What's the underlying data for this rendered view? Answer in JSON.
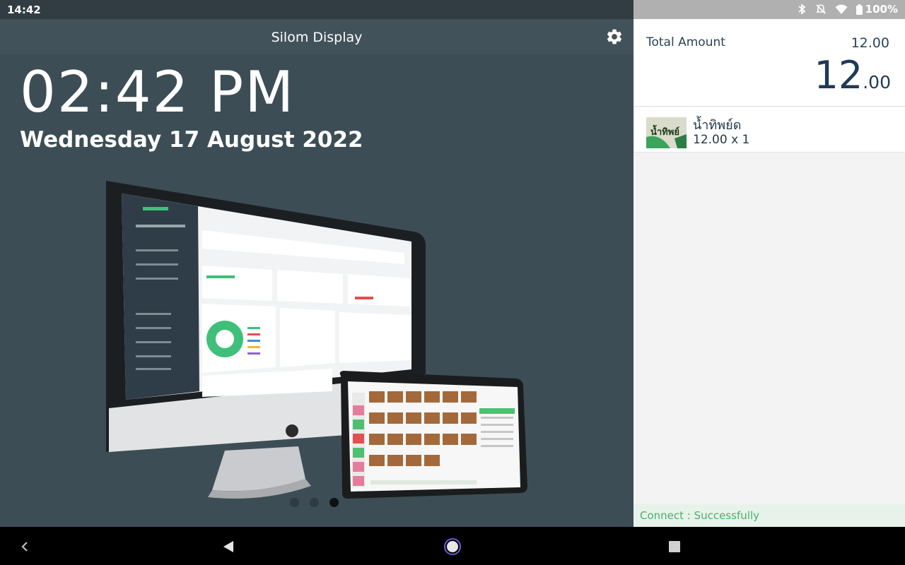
{
  "status_bar": {
    "time": "14:42",
    "battery": "100%",
    "icons": [
      "bluetooth-icon",
      "notifications-off-icon",
      "wifi-icon",
      "battery-icon"
    ]
  },
  "app_bar": {
    "title": "Silom Display",
    "settings_icon": "gear-icon"
  },
  "display": {
    "time": "02:42 PM",
    "date": "Wednesday 17 August 2022",
    "carousel": {
      "count": 3,
      "active_index": 3
    }
  },
  "order": {
    "total_label": "Total Amount",
    "total_small": "12.00",
    "total_big_int": "12",
    "total_big_dec": ".00",
    "items": [
      {
        "name": "น้ำทิพย์ด",
        "qty_line": "12.00 x 1",
        "thumb_text": "น้ำทิพย์"
      }
    ]
  },
  "connection": {
    "status": "Connect : Successfully"
  },
  "nav": {
    "icons": [
      "back-icon",
      "home-icon",
      "recents-icon",
      "nav-chevron-icon"
    ]
  },
  "colors": {
    "panel_bg": "#3c4d55",
    "accent_green": "#4caf6b",
    "text_navy": "#1e3a55"
  }
}
